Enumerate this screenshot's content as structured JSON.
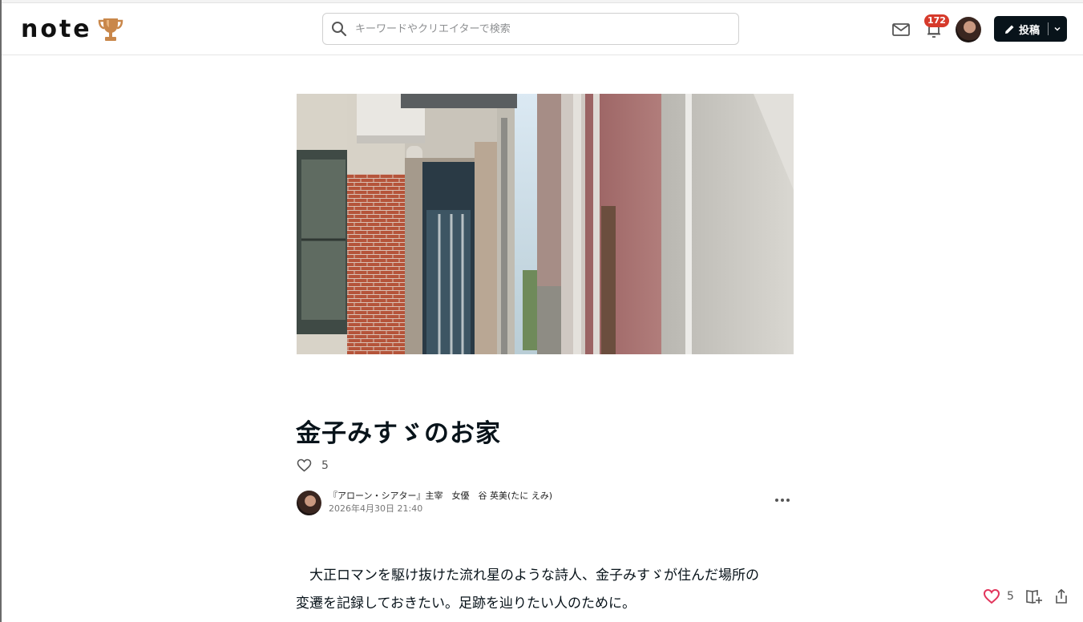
{
  "header": {
    "logo_text": "note",
    "search_placeholder": "キーワードやクリエイターで検索",
    "notification_count": "172",
    "post_button_label": "投稿",
    "icons": [
      "trophy-icon",
      "search-icon",
      "mail-icon",
      "notification-bell-icon",
      "chevron-down-icon",
      "pencil-icon"
    ]
  },
  "article": {
    "title": "金子みすゞのお家",
    "like_count": "5",
    "author_name": "『アローン・シアター』主宰　女優　谷 英美(たに えみ)",
    "published_date": "2026年4月30日 21:40",
    "body_line1": "　大正ロマンを駆け抜けた流れ星のような詩人、金子みすゞが住んだ場所の",
    "body_line2": "変遷を記録しておきたい。足跡を辿りたい人のために。"
  },
  "floating_bar": {
    "like_count": "5",
    "icons": [
      "heart-icon",
      "add-to-magazine-icon",
      "share-icon"
    ]
  },
  "colors": {
    "text": "#08131a",
    "button_dark": "#08131a",
    "badge_red": "#d63a2b",
    "like_pink": "#e2345b"
  }
}
